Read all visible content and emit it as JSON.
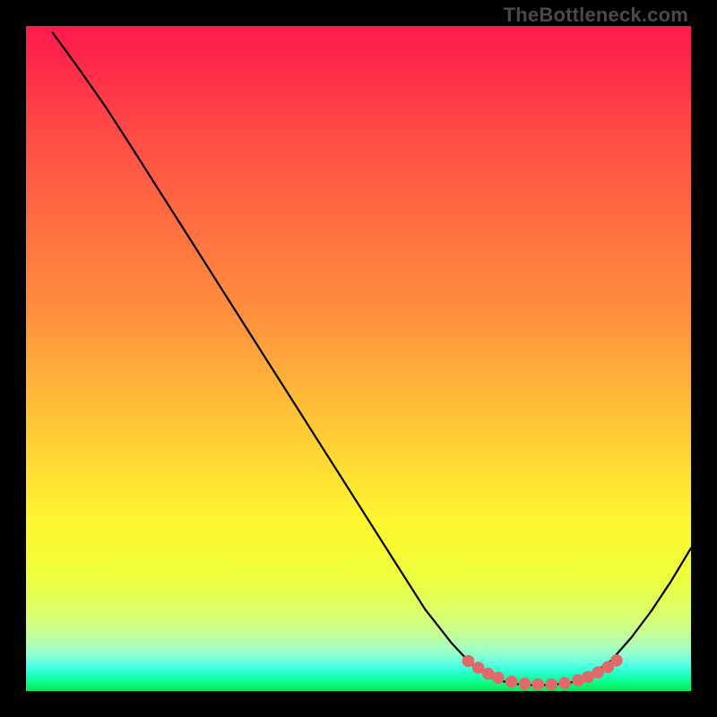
{
  "watermark": "TheBottleneck.com",
  "colors": {
    "curve_stroke": "#000000",
    "marker_fill": "#e06a6a",
    "marker_stroke": "#c85a5a"
  },
  "chart_data": {
    "type": "line",
    "title": "",
    "xlabel": "",
    "ylabel": "",
    "xlim": [
      0,
      100
    ],
    "ylim": [
      0,
      100
    ],
    "grid": false,
    "curve_xy": [
      [
        4,
        99
      ],
      [
        8,
        93.5
      ],
      [
        12,
        87.8
      ],
      [
        16,
        81.6
      ],
      [
        20,
        75.3
      ],
      [
        24,
        69.0
      ],
      [
        28,
        62.7
      ],
      [
        32,
        56.4
      ],
      [
        36,
        50.1
      ],
      [
        40,
        43.8
      ],
      [
        44,
        37.5
      ],
      [
        48,
        31.2
      ],
      [
        52,
        24.9
      ],
      [
        56,
        18.6
      ],
      [
        60,
        12.3
      ],
      [
        64,
        7.2
      ],
      [
        67,
        4.0
      ],
      [
        70,
        2.0
      ],
      [
        73,
        1.1
      ],
      [
        76,
        0.9
      ],
      [
        79,
        0.9
      ],
      [
        82,
        1.3
      ],
      [
        85,
        2.4
      ],
      [
        88,
        4.6
      ],
      [
        91,
        8.0
      ],
      [
        94,
        12.0
      ],
      [
        97,
        16.5
      ],
      [
        100,
        21.5
      ]
    ],
    "marker_xy": [
      [
        66.5,
        4.5
      ],
      [
        68.0,
        3.5
      ],
      [
        69.5,
        2.6
      ],
      [
        71.0,
        2.0
      ],
      [
        73.0,
        1.4
      ],
      [
        75.0,
        1.1
      ],
      [
        77.0,
        1.0
      ],
      [
        79.0,
        1.0
      ],
      [
        81.0,
        1.2
      ],
      [
        83.0,
        1.6
      ],
      [
        84.5,
        2.1
      ],
      [
        86.0,
        2.8
      ],
      [
        87.5,
        3.6
      ],
      [
        88.8,
        4.6
      ]
    ]
  }
}
